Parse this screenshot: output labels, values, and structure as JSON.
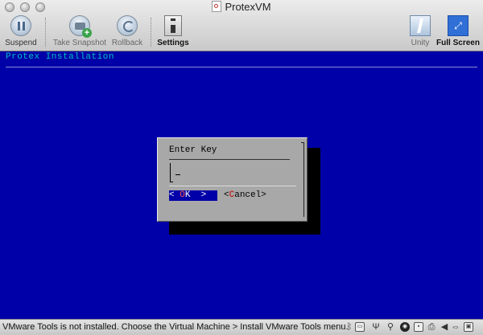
{
  "window": {
    "title": "ProtexVM"
  },
  "toolbar": {
    "suspend_label": "Suspend",
    "snapshot_label": "Take Snapshot",
    "rollback_label": "Rollback",
    "settings_label": "Settings",
    "unity_label": "Unity",
    "fullscreen_label": "Full Screen"
  },
  "guest": {
    "header_title": "Protex Installation",
    "dialog": {
      "label": "Enter Key",
      "input_value": "",
      "ok_left": "< ",
      "ok_hot": "O",
      "ok_right": "K  >",
      "cancel_left": "<",
      "cancel_hot": "C",
      "cancel_right": "ancel>"
    },
    "colors": {
      "background": "#0000a8",
      "title_text": "#00c0c0",
      "dialog_bg": "#a8a8a8",
      "hotkey": "#c00000"
    }
  },
  "statusbar": {
    "message": "VMware Tools is not installed. Choose the Virtual Machine > Install VMware Tools menu.",
    "icons": [
      "bluetooth-icon",
      "hard-disk-icon",
      "usb-icon",
      "network-icon",
      "cd-icon",
      "floppy-icon",
      "printer-icon",
      "sound-icon",
      "serial-icon",
      "display-icon"
    ]
  }
}
